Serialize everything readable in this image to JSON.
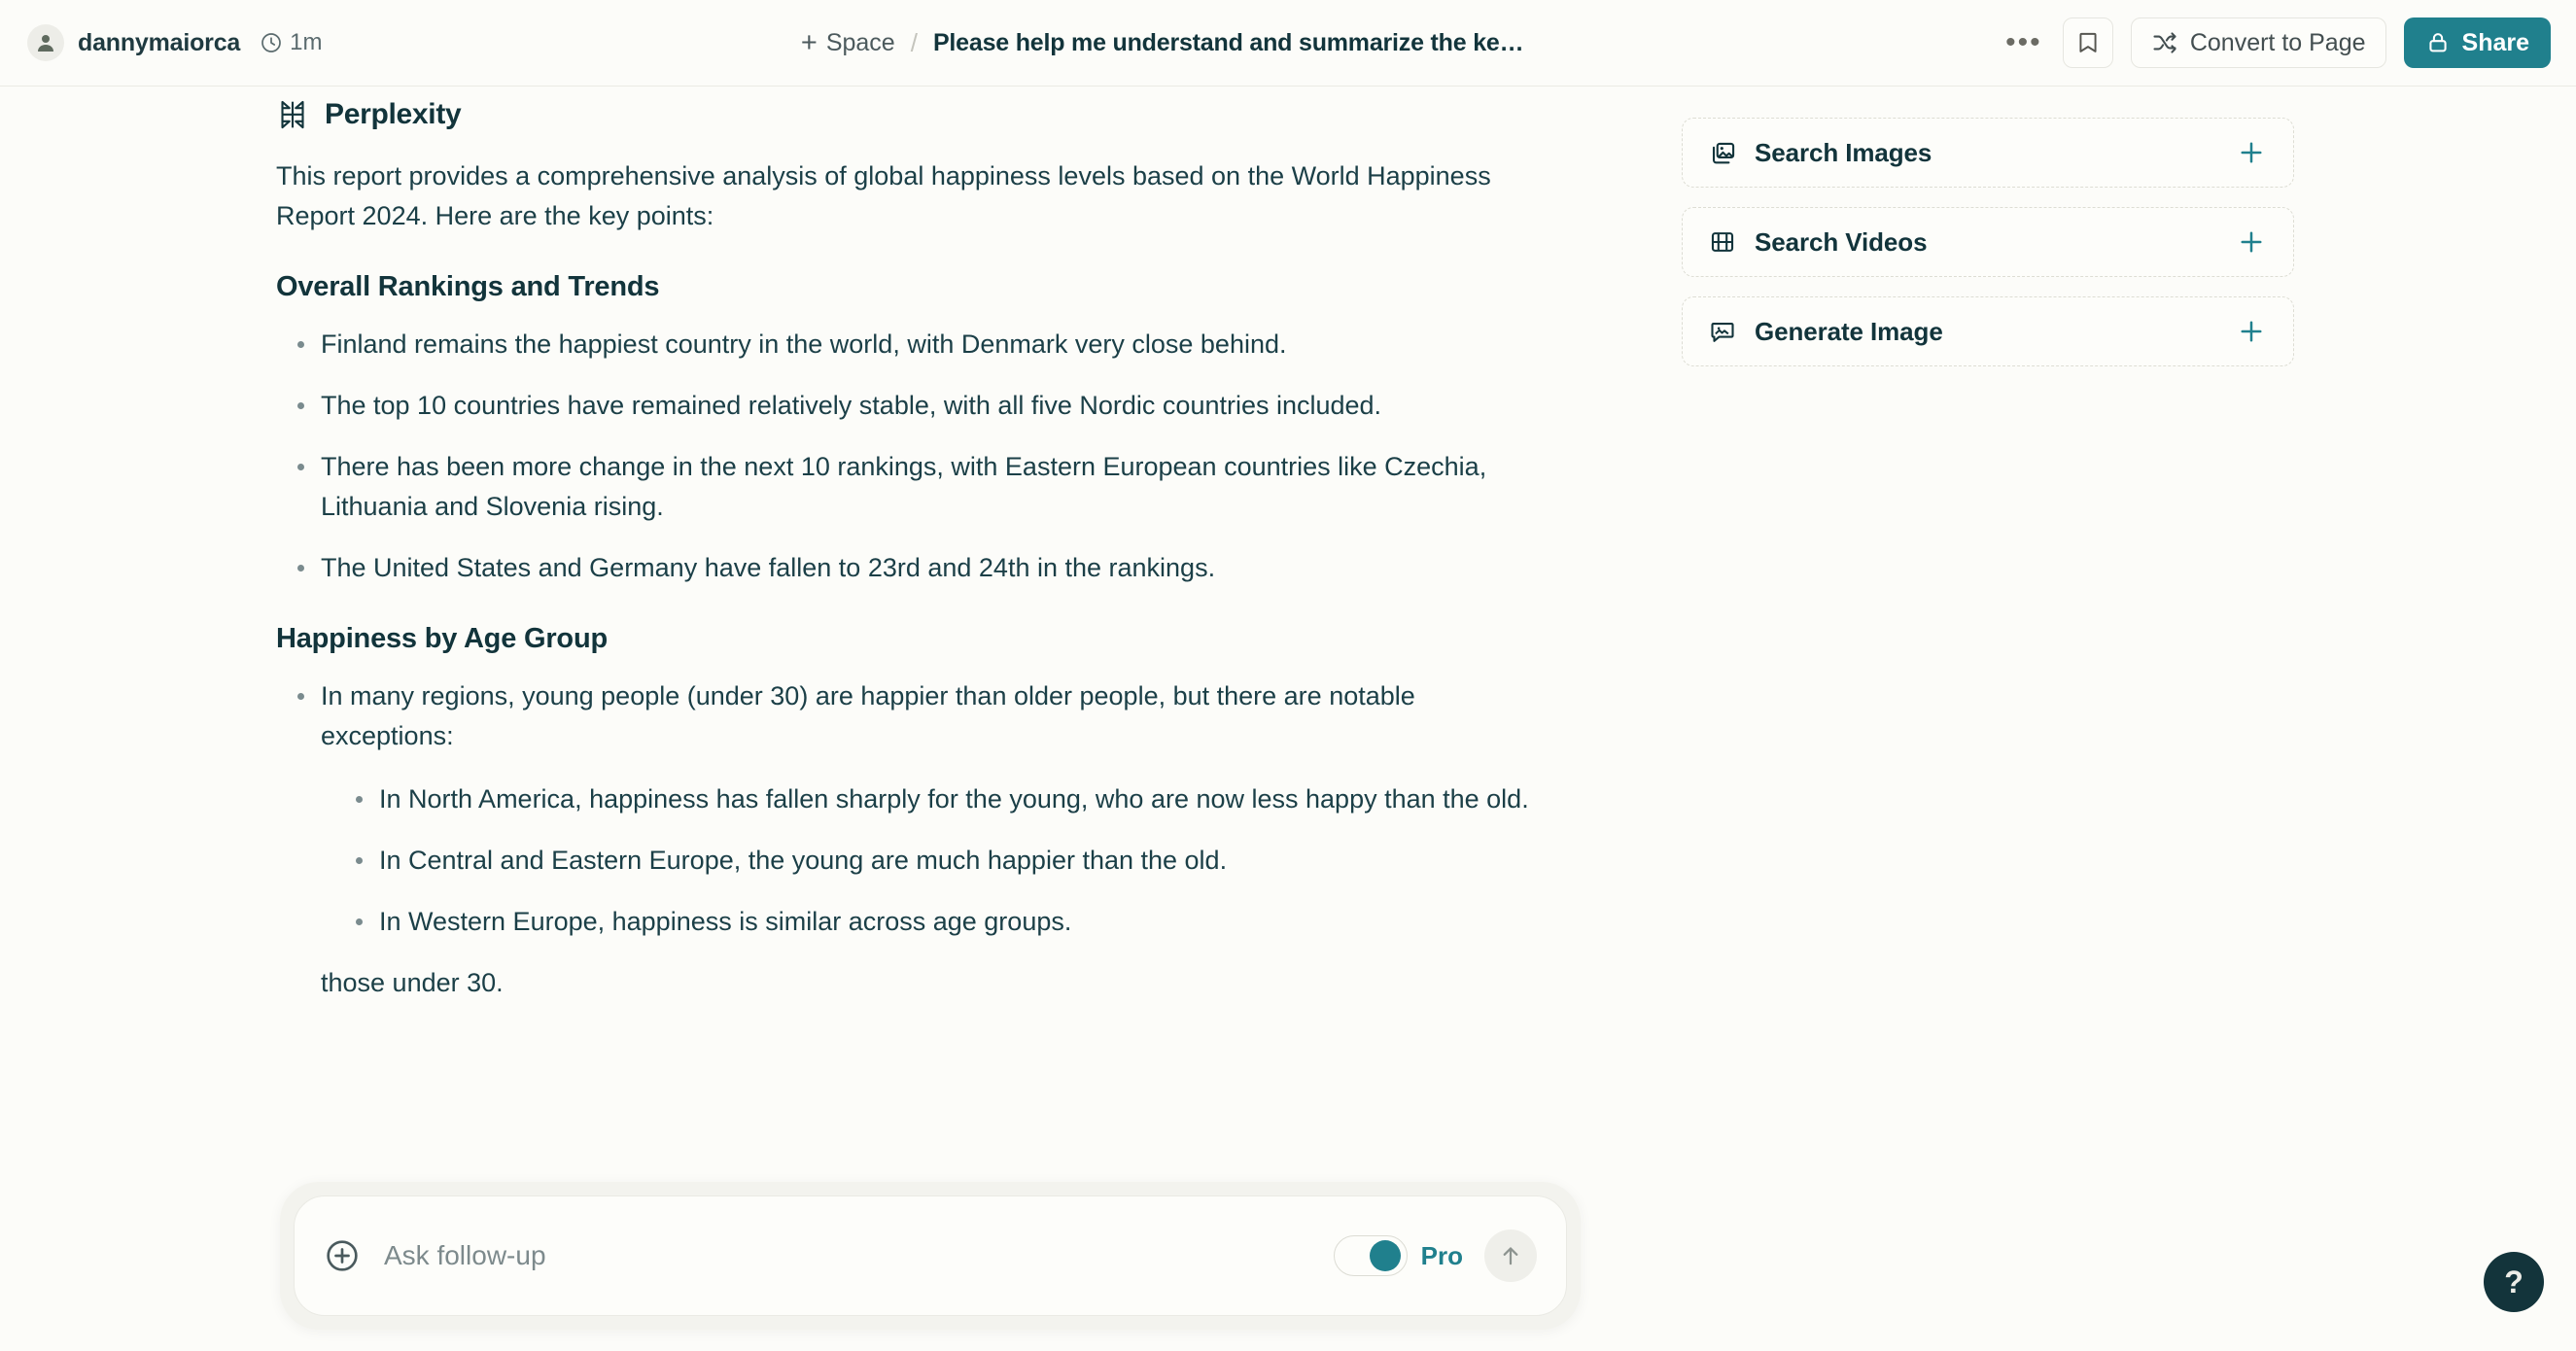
{
  "header": {
    "username": "dannymaiorca",
    "time_ago": "1m",
    "space_label": "Space",
    "separator": "/",
    "thread_title": "Please help me understand and summarize the ke…",
    "more_label": "•••",
    "convert_label": "Convert to Page",
    "share_label": "Share",
    "icons": {
      "avatar": "person-icon",
      "clock": "clock-icon",
      "plus": "plus-icon",
      "bookmark": "bookmark-icon",
      "shuffle": "shuffle-icon",
      "lock": "lock-icon"
    },
    "accent_color": "#20808D"
  },
  "answer": {
    "brand": "Perplexity",
    "intro": "This report provides a comprehensive analysis of global happiness levels based on the World Happiness Report 2024. Here are the key points:",
    "sections": [
      {
        "heading": "Overall Rankings and Trends",
        "bullets": [
          "Finland remains the happiest country in the world, with Denmark very close behind.",
          "The top 10 countries have remained relatively stable, with all five Nordic countries included.",
          "There has been more change in the next 10 rankings, with Eastern European countries like Czechia, Lithuania and Slovenia rising.",
          "The United States and Germany have fallen to 23rd and 24th in the rankings."
        ]
      },
      {
        "heading": "Happiness by Age Group",
        "bullets": [
          "In many regions, young people (under 30) are happier than older people, but there are notable exceptions:"
        ],
        "sub_bullets": [
          "In North America, happiness has fallen sharply for the young, who are now less happy than the old.",
          "In Central and Eastern Europe, the young are much happier than the old.",
          "In Western Europe, happiness is similar across age groups."
        ],
        "clipped_line": "those under 30."
      }
    ]
  },
  "side_actions": [
    {
      "label": "Search Images",
      "icon": "images-icon",
      "add": "plus-icon"
    },
    {
      "label": "Search Videos",
      "icon": "video-icon",
      "add": "plus-icon"
    },
    {
      "label": "Generate Image",
      "icon": "generate-image-icon",
      "add": "plus-icon"
    }
  ],
  "followup": {
    "placeholder": "Ask follow-up",
    "value": "",
    "attach_icon": "plus-circle-icon",
    "pro_label": "Pro",
    "pro_enabled": true,
    "send_icon": "arrow-up-icon"
  },
  "help": {
    "label": "?"
  }
}
